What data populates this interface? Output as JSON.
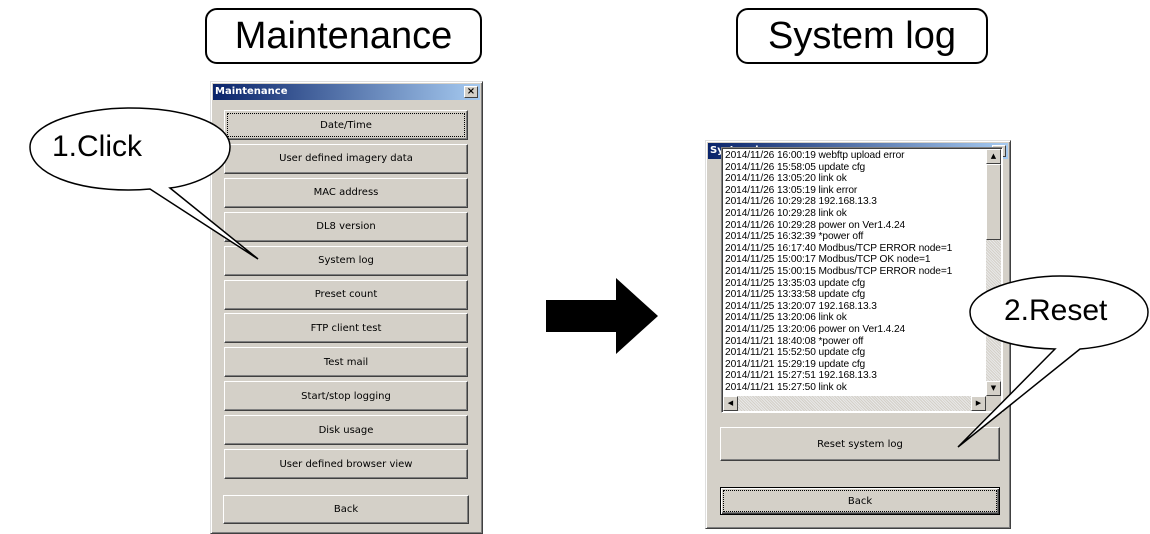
{
  "headings": {
    "maintenance": "Maintenance",
    "system_log": "System log"
  },
  "maintenance_window": {
    "title": "Maintenance",
    "close_glyph": "×",
    "buttons": [
      "Date/Time",
      "User defined imagery data",
      "MAC address",
      "DL8 version",
      "System log",
      "Preset count",
      "FTP client test",
      "Test mail",
      "Start/stop logging",
      "Disk usage",
      "User defined browser view"
    ],
    "back_label": "Back"
  },
  "system_log_window": {
    "title": "System log",
    "close_glyph": "×",
    "log_lines": [
      "2014/11/26 16:00:19 webftp upload error",
      "2014/11/26 15:58:05 update cfg",
      "2014/11/26 13:05:20 link ok",
      "2014/11/26 13:05:19 link error",
      "2014/11/26 10:29:28 192.168.13.3",
      "2014/11/26 10:29:28 link ok",
      "2014/11/26 10:29:28 power on Ver1.4.24",
      "2014/11/25 16:32:39 *power off",
      "2014/11/25 16:17:40 Modbus/TCP ERROR node=1",
      "2014/11/25 15:00:17 Modbus/TCP OK node=1",
      "2014/11/25 15:00:15 Modbus/TCP ERROR node=1",
      "2014/11/25 13:35:03 update cfg",
      "2014/11/25 13:33:58 update cfg",
      "2014/11/25 13:20:07 192.168.13.3",
      "2014/11/25 13:20:06 link ok",
      "2014/11/25 13:20:06 power on Ver1.4.24",
      "2014/11/21 18:40:08 *power off",
      "2014/11/21 15:52:50 update cfg",
      "2014/11/21 15:29:19 update cfg",
      "2014/11/21 15:27:51 192.168.13.3",
      "2014/11/21 15:27:50 link ok"
    ],
    "reset_label": "Reset system log",
    "back_label": "Back"
  },
  "callouts": {
    "click": "1.Click",
    "reset": "2.Reset"
  },
  "colors": {
    "window_bg": "#d4d0c8",
    "titlebar_start": "#0a246a",
    "titlebar_end": "#a6caf0"
  }
}
